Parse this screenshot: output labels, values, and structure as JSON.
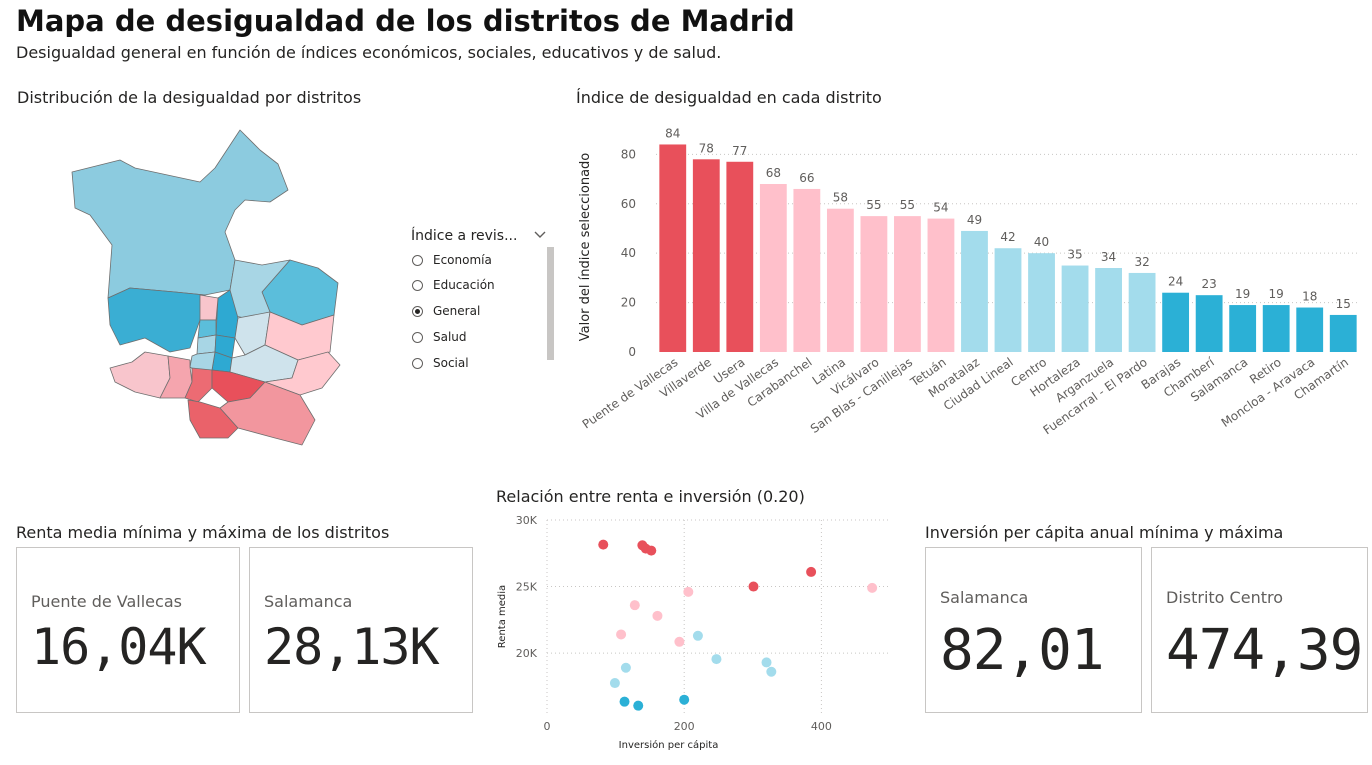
{
  "header": {
    "title": "Mapa de desigualdad de los distritos de Madrid",
    "subtitle": "Desigualdad general en función de índices económicos, sociales, educativos y de salud."
  },
  "map": {
    "title": "Distribución de la desigualdad por distritos"
  },
  "slicer": {
    "title": "Índice a revis...",
    "options": [
      "Economía",
      "Educación",
      "General",
      "Salud",
      "Social"
    ],
    "selected": "General"
  },
  "colors": {
    "very_high": "#e8505b",
    "high": "#ffc0cb",
    "low": "#a3dcec",
    "very_low": "#2bb0d6",
    "grid": "#c8c6c4"
  },
  "cards": {
    "renta": {
      "title": "Renta media mínima y máxima de los distritos",
      "min_label": "Puente de Vallecas",
      "min_value": "16,04K",
      "max_label": "Salamanca",
      "max_value": "28,13K"
    },
    "inversion": {
      "title": "Inversión per cápita anual mínima y máxima",
      "min_label": "Salamanca",
      "min_value": "82,01",
      "max_label": "Distrito Centro",
      "max_value": "474,39"
    }
  },
  "chart_data": [
    {
      "type": "bar",
      "title": "Índice de desigualdad en cada distrito",
      "xlabel": "",
      "ylabel": "Valor del índice seleccionado",
      "ylim": [
        0,
        85
      ],
      "yticks": [
        0,
        20,
        40,
        60,
        80
      ],
      "grid": true,
      "categories": [
        "Puente de Vallecas",
        "Villaverde",
        "Usera",
        "Villa de Vallecas",
        "Carabanchel",
        "Latina",
        "Vicálvaro",
        "San Blas - Canillejas",
        "Tetuán",
        "Moratalaz",
        "Ciudad Lineal",
        "Centro",
        "Hortaleza",
        "Arganzuela",
        "Fuencarral - El Pardo",
        "Barajas",
        "Chamberí",
        "Salamanca",
        "Retiro",
        "Moncloa - Aravaca",
        "Chamartín"
      ],
      "values": [
        84,
        78,
        77,
        68,
        66,
        58,
        55,
        55,
        54,
        49,
        42,
        40,
        35,
        34,
        32,
        24,
        23,
        19,
        19,
        18,
        15
      ],
      "value_labels": [
        "84",
        "78",
        "77",
        "68",
        "66",
        "58",
        "55",
        "55",
        "54",
        "49",
        "42",
        "40",
        "35",
        "34",
        "32",
        "24",
        "23",
        "19",
        "19",
        "18",
        "15"
      ],
      "bar_colors": [
        "very_high",
        "very_high",
        "very_high",
        "high",
        "high",
        "high",
        "high",
        "high",
        "high",
        "low",
        "low",
        "low",
        "low",
        "low",
        "low",
        "very_low",
        "very_low",
        "very_low",
        "very_low",
        "very_low",
        "very_low"
      ]
    },
    {
      "type": "scatter",
      "title": "Relación entre renta e inversión (0.20)",
      "xlabel": "Inversión per cápita",
      "ylabel": "Renta media",
      "xlim": [
        0,
        500
      ],
      "ylim": [
        15500,
        30000
      ],
      "xticks": [
        0,
        200,
        400
      ],
      "xtick_labels": [
        "0",
        "200",
        "400"
      ],
      "yticks": [
        20000,
        25000,
        30000
      ],
      "ytick_labels": [
        "20K",
        "25K",
        "30K"
      ],
      "grid": true,
      "points": [
        {
          "x": 82,
          "y": 28150,
          "c": "very_high"
        },
        {
          "x": 139,
          "y": 28100,
          "c": "very_high"
        },
        {
          "x": 144,
          "y": 27850,
          "c": "very_high"
        },
        {
          "x": 152,
          "y": 27700,
          "c": "very_high"
        },
        {
          "x": 301,
          "y": 25000,
          "c": "very_high"
        },
        {
          "x": 385,
          "y": 26100,
          "c": "very_high"
        },
        {
          "x": 474,
          "y": 24900,
          "c": "high"
        },
        {
          "x": 206,
          "y": 24600,
          "c": "high"
        },
        {
          "x": 128,
          "y": 23600,
          "c": "high"
        },
        {
          "x": 161,
          "y": 22800,
          "c": "high"
        },
        {
          "x": 108,
          "y": 21400,
          "c": "high"
        },
        {
          "x": 193,
          "y": 20850,
          "c": "high"
        },
        {
          "x": 220,
          "y": 21300,
          "c": "low"
        },
        {
          "x": 247,
          "y": 19550,
          "c": "low"
        },
        {
          "x": 320,
          "y": 19300,
          "c": "low"
        },
        {
          "x": 327,
          "y": 18600,
          "c": "low"
        },
        {
          "x": 115,
          "y": 18900,
          "c": "low"
        },
        {
          "x": 99,
          "y": 17750,
          "c": "low"
        },
        {
          "x": 200,
          "y": 16500,
          "c": "very_low"
        },
        {
          "x": 113,
          "y": 16350,
          "c": "very_low"
        },
        {
          "x": 133,
          "y": 16050,
          "c": "very_low"
        }
      ]
    }
  ]
}
